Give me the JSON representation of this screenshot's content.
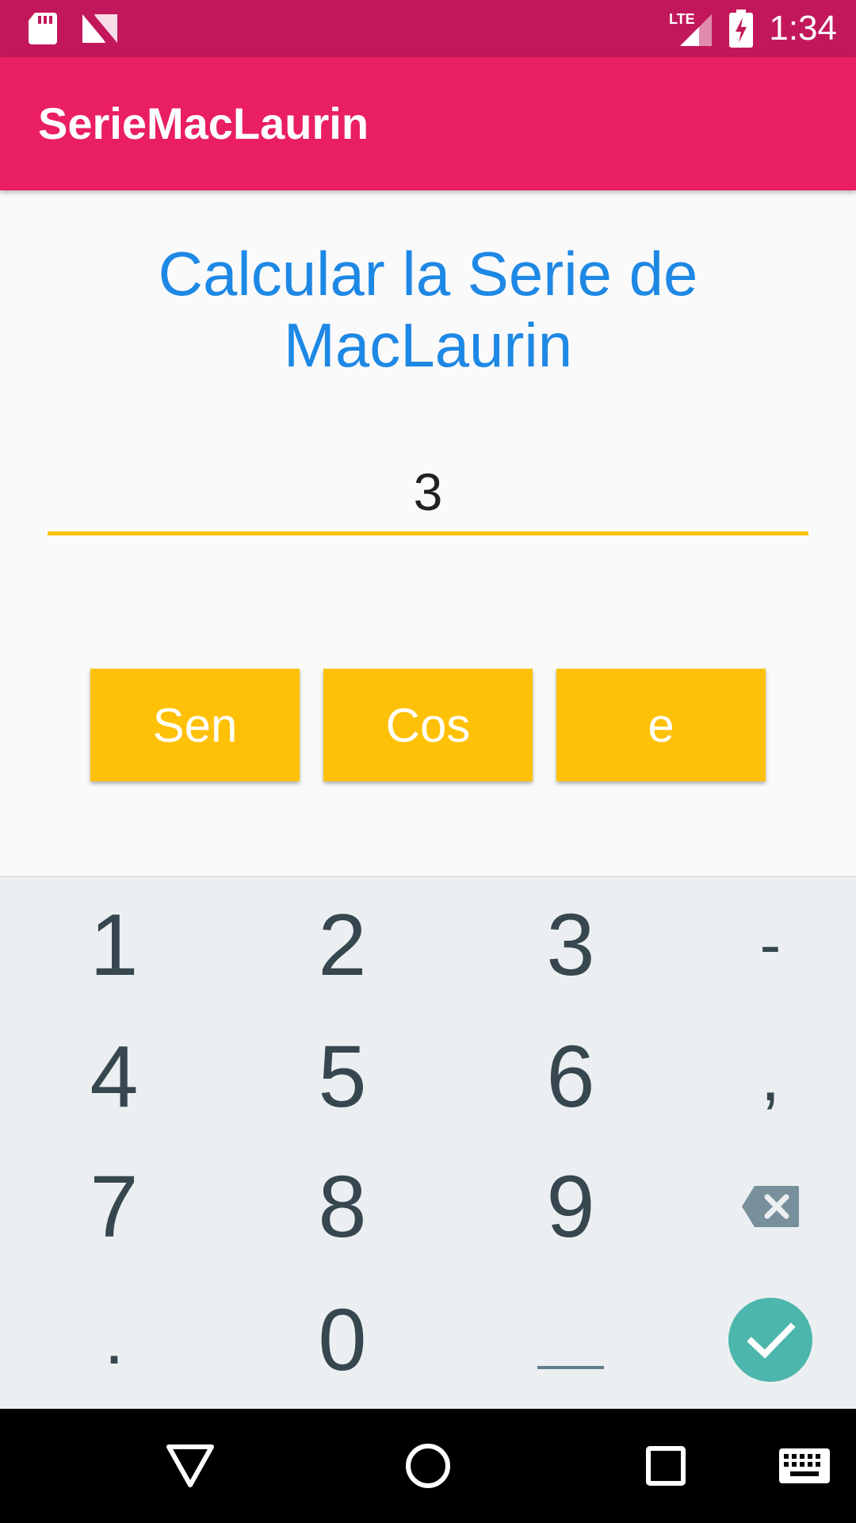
{
  "status_bar": {
    "time": "1:34",
    "network": "LTE",
    "icons": [
      "sd-card-icon",
      "n-logo-icon",
      "signal-icon",
      "battery-charging-icon"
    ]
  },
  "app_bar": {
    "title": "SerieMacLaurin"
  },
  "main": {
    "heading_line1": "Calcular la Serie de",
    "heading_line2": "MacLaurin",
    "input_value": "3",
    "buttons": {
      "sen": "Sen",
      "cos": "Cos",
      "e": "e"
    }
  },
  "keyboard": {
    "row1": [
      "1",
      "2",
      "3",
      "-"
    ],
    "row2": [
      "4",
      "5",
      "6",
      ","
    ],
    "row3": [
      "7",
      "8",
      "9"
    ],
    "row4_left": ".",
    "row4_mid": "0",
    "row4_space": "space-key-icon",
    "delete_icon": "backspace-icon",
    "enter_icon": "check-icon"
  },
  "nav_bar": {
    "icons": [
      "back-icon",
      "home-icon",
      "recents-icon",
      "keyboard-icon"
    ]
  },
  "colors": {
    "status_bar": "#c2185b",
    "app_bar": "#e91e63",
    "heading": "#1e88e5",
    "accent": "#ffc107",
    "keyboard_bg": "#eceff1",
    "key_text": "#37474f",
    "enter_key": "#4db6ac"
  }
}
